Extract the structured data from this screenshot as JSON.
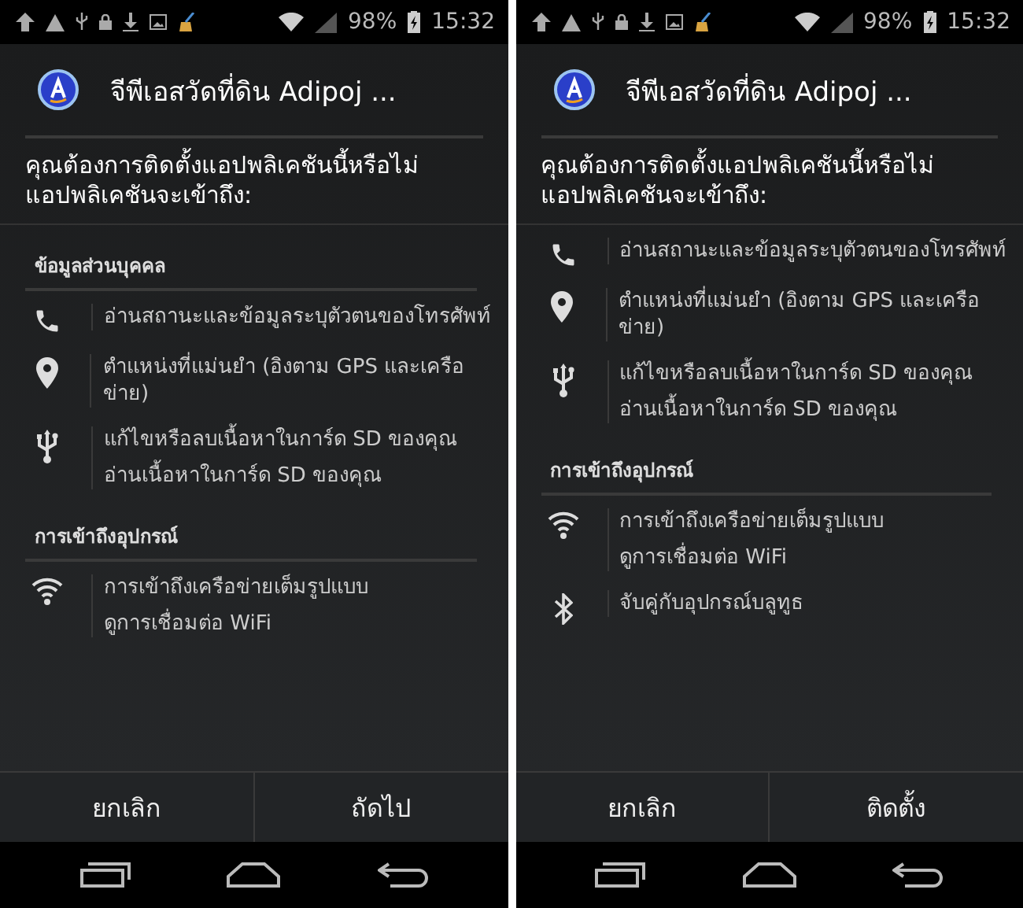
{
  "screens": [
    {
      "status_bar": {
        "battery": "98%",
        "time": "15:32"
      },
      "title": "จีพีเอสวัดที่ดิน Adipoj ...",
      "message": "คุณต้องการติดตั้งแอปพลิเคชันนี้หรือไม่ แอปพลิเคชันจะเข้าถึง:",
      "permissions": [
        {
          "kind": "header",
          "text": "ข้อมูลส่วนบุคคล"
        },
        {
          "kind": "phone",
          "lines": [
            "อ่านสถานะและข้อมูลระบุตัวตนของโทรศัพท์"
          ]
        },
        {
          "kind": "location",
          "lines": [
            "ตำแหน่งที่แม่นยำ (อิงตาม GPS และเครือข่าย)"
          ]
        },
        {
          "kind": "usb",
          "lines": [
            "แก้ไขหรือลบเนื้อหาในการ์ด SD ของคุณ",
            "อ่านเนื้อหาในการ์ด SD ของคุณ"
          ]
        },
        {
          "kind": "header",
          "text": "การเข้าถึงอุปกรณ์"
        },
        {
          "kind": "wifi",
          "lines": [
            "การเข้าถึงเครือข่ายเต็มรูปแบบ",
            "ดูการเชื่อมต่อ WiFi"
          ]
        }
      ],
      "buttons": [
        "ยกเลิก",
        "ถัดไป"
      ]
    },
    {
      "status_bar": {
        "battery": "98%",
        "time": "15:32"
      },
      "title": "จีพีเอสวัดที่ดิน Adipoj ...",
      "message": "คุณต้องการติดตั้งแอปพลิเคชันนี้หรือไม่ แอปพลิเคชันจะเข้าถึง:",
      "permissions": [
        {
          "kind": "phone",
          "lines": [
            "อ่านสถานะและข้อมูลระบุตัวตนของโทรศัพท์"
          ]
        },
        {
          "kind": "location",
          "lines": [
            "ตำแหน่งที่แม่นยำ (อิงตาม GPS และเครือข่าย)"
          ]
        },
        {
          "kind": "usb",
          "lines": [
            "แก้ไขหรือลบเนื้อหาในการ์ด SD ของคุณ",
            "อ่านเนื้อหาในการ์ด SD ของคุณ"
          ]
        },
        {
          "kind": "header",
          "text": "การเข้าถึงอุปกรณ์"
        },
        {
          "kind": "wifi",
          "lines": [
            "การเข้าถึงเครือข่ายเต็มรูปแบบ",
            "ดูการเชื่อมต่อ WiFi"
          ]
        },
        {
          "kind": "bluetooth",
          "lines": [
            "จับคู่กับอุปกรณ์บลูทูธ"
          ]
        }
      ],
      "buttons": [
        "ยกเลิก",
        "ติดตั้ง"
      ]
    }
  ]
}
